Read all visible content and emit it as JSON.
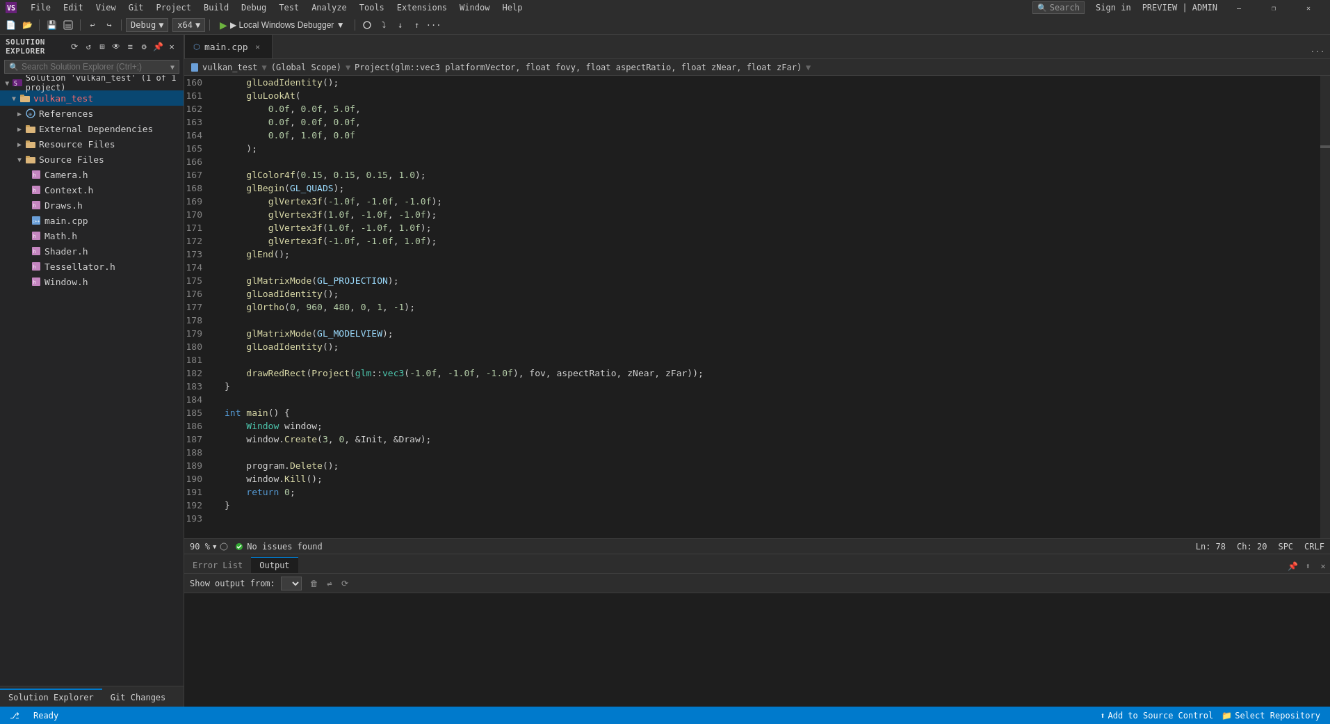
{
  "titlebar": {
    "icon": "VS",
    "menus": [
      "File",
      "Edit",
      "View",
      "Git",
      "Project",
      "Build",
      "Debug",
      "Test",
      "Analyze",
      "Tools",
      "Extensions",
      "Window",
      "Help"
    ],
    "search_placeholder": "Search",
    "sign_in": "Sign in",
    "preview_admin": "PREVIEW | ADMIN",
    "window_controls": [
      "—",
      "❐",
      "✕"
    ]
  },
  "toolbar": {
    "debug_config": "Debug",
    "platform": "x64",
    "run_label": "▶ Local Windows Debugger ▼"
  },
  "solution_explorer": {
    "title": "Solution Explorer",
    "search_placeholder": "Search Solution Explorer (Ctrl+;)",
    "solution_name": "Solution 'vulkan_test' (1 of 1 project)",
    "project_name": "vulkan_test",
    "items": [
      {
        "label": "References",
        "type": "references",
        "level": 2,
        "expanded": false
      },
      {
        "label": "External Dependencies",
        "type": "folder",
        "level": 2,
        "expanded": false
      },
      {
        "label": "Resource Files",
        "type": "folder",
        "level": 2,
        "expanded": false
      },
      {
        "label": "Source Files",
        "type": "folder",
        "level": 2,
        "expanded": true
      },
      {
        "label": "Camera.h",
        "type": "h",
        "level": 3
      },
      {
        "label": "Context.h",
        "type": "h",
        "level": 3
      },
      {
        "label": "Draws.h",
        "type": "h",
        "level": 3
      },
      {
        "label": "main.cpp",
        "type": "cpp",
        "level": 3,
        "selected": true
      },
      {
        "label": "Math.h",
        "type": "h",
        "level": 3
      },
      {
        "label": "Shader.h",
        "type": "h",
        "level": 3
      },
      {
        "label": "Tessellator.h",
        "type": "h",
        "level": 3
      },
      {
        "label": "Window.h",
        "type": "h",
        "level": 3
      }
    ]
  },
  "editor": {
    "tabs": [
      {
        "label": "main.cpp",
        "active": true,
        "icon": "cpp"
      }
    ],
    "nav_file": "vulkan_test",
    "nav_scope": "(Global Scope)",
    "nav_function": "Project(glm::vec3 platformVector, float fovy, float aspectRatio, float zNear, float zFar)",
    "lines": [
      {
        "num": 160,
        "code": "    <fn>glLoadIdentity</fn>();"
      },
      {
        "num": 161,
        "code": "    <fn>gluLookAt</fn>("
      },
      {
        "num": 162,
        "code": "        <num>0.0f</num>, <num>0.0f</num>, <num>5.0f</num>,"
      },
      {
        "num": 163,
        "code": "        <num>0.0f</num>, <num>0.0f</num>, <num>0.0f</num>,"
      },
      {
        "num": 164,
        "code": "        <num>0.0f</num>, <num>1.0f</num>, <num>0.0f</num>"
      },
      {
        "num": 165,
        "code": "    );"
      },
      {
        "num": 166,
        "code": ""
      },
      {
        "num": 167,
        "code": "    <fn>glColor4f</fn>(<num>0.15</num>, <num>0.15</num>, <num>0.15</num>, <num>1.0</num>);"
      },
      {
        "num": 168,
        "code": "    <fn>glBegin</fn>(<pn>GL_QUADS</pn>);"
      },
      {
        "num": 169,
        "code": "        <fn>glVertex3f</fn>(<num>-1.0f</num>, <num>-1.0f</num>, <num>-1.0f</num>);"
      },
      {
        "num": 170,
        "code": "        <fn>glVertex3f</fn>(<num>1.0f</num>, <num>-1.0f</num>, <num>-1.0f</num>);"
      },
      {
        "num": 171,
        "code": "        <fn>glVertex3f</fn>(<num>1.0f</num>, <num>-1.0f</num>, <num>1.0f</num>);"
      },
      {
        "num": 172,
        "code": "        <fn>glVertex3f</fn>(<num>-1.0f</num>, <num>-1.0f</num>, <num>1.0f</num>);"
      },
      {
        "num": 173,
        "code": "    <fn>glEnd</fn>();"
      },
      {
        "num": 174,
        "code": ""
      },
      {
        "num": 175,
        "code": "    <fn>glMatrixMode</fn>(<pn>GL_PROJECTION</pn>);"
      },
      {
        "num": 176,
        "code": "    <fn>glLoadIdentity</fn>();"
      },
      {
        "num": 177,
        "code": "    <fn>glOrtho</fn>(<num>0</num>, <num>960</num>, <num>480</num>, <num>0</num>, <num>1</num>, <num>-1</num>);"
      },
      {
        "num": 178,
        "code": ""
      },
      {
        "num": 179,
        "code": "    <fn>glMatrixMode</fn>(<pn>GL_MODELVIEW</pn>);"
      },
      {
        "num": 180,
        "code": "    <fn>glLoadIdentity</fn>();"
      },
      {
        "num": 181,
        "code": ""
      },
      {
        "num": 182,
        "code": "    <fn>drawRedRect</fn>(<fn>Project</fn>(<tp>glm</tp>::<tp>vec3</tp>(<num>-1.0f</num>, <num>-1.0f</num>, <num>-1.0f</num>), fov, aspectRatio, zNear, zFar));"
      },
      {
        "num": 183,
        "code": "}"
      },
      {
        "num": 184,
        "code": ""
      },
      {
        "num": 185,
        "code": "<kw>int</kw> <fn>main</fn>() {"
      },
      {
        "num": 186,
        "code": "    <tp>Window</tp> window;"
      },
      {
        "num": 187,
        "code": "    window.<fn>Create</fn>(<num>3</num>, <num>0</num>, &Init, &Draw);"
      },
      {
        "num": 188,
        "code": ""
      },
      {
        "num": 189,
        "code": "    program.<fn>Delete</fn>();"
      },
      {
        "num": 190,
        "code": "    window.<fn>Kill</fn>();"
      },
      {
        "num": 191,
        "code": "    <kw>return</kw> <num>0</num>;"
      },
      {
        "num": 192,
        "code": "}"
      },
      {
        "num": 193,
        "code": ""
      }
    ]
  },
  "status_bar": {
    "zoom": "90 %",
    "issues": "No issues found",
    "ln": "Ln: 78",
    "ch": "Ch: 20",
    "eol": "SPC",
    "line_ending": "CRLF"
  },
  "output_panel": {
    "tabs": [
      "Error List",
      "Output"
    ],
    "active_tab": "Output",
    "show_output_label": "Show output from:",
    "show_output_value": ""
  },
  "bottom_status": {
    "ready": "Ready",
    "add_to_source_control": "Add to Source Control",
    "select_repository": "Select Repository"
  },
  "sidebar_bottom_tabs": [
    "Solution Explorer",
    "Git Changes"
  ]
}
